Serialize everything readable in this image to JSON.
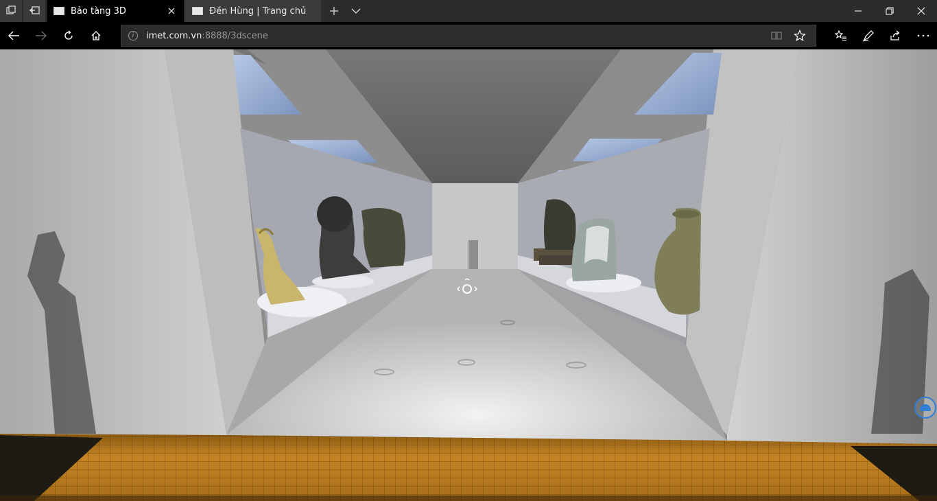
{
  "browser": {
    "tabs": [
      {
        "label": "Bảo tàng 3D",
        "active": true
      },
      {
        "label": "Đền Hùng | Trang chủ",
        "active": false
      }
    ],
    "address": {
      "host": "imet.com.vn",
      "path": ":8888/3dscene"
    },
    "icons": {
      "tab_preview": "tab-preview-icon",
      "set_aside": "set-aside-tabs-icon",
      "new_tab": "plus-icon",
      "tab_list": "chevron-down-icon",
      "minimize": "minimize-icon",
      "restore": "restore-icon",
      "close": "close-icon",
      "back": "arrow-left-icon",
      "forward": "arrow-right-icon",
      "refresh": "refresh-icon",
      "home": "home-icon",
      "info": "info-icon",
      "reading_view": "reading-view-icon",
      "favorite": "star-icon",
      "favorites_hub": "favorites-list-icon",
      "notes": "pen-icon",
      "share": "share-icon",
      "more": "more-icon"
    }
  },
  "scene": {
    "nav_cursor_icon": "navigation-cursor-icon",
    "fab_icon": "map-icon",
    "colors": {
      "wall": "#b8b8b8",
      "floor": "#c9c9c9",
      "skylight": "#9fb6dd",
      "carpet": "#b57a1f"
    }
  }
}
